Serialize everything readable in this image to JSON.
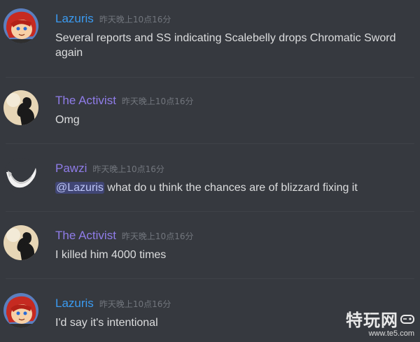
{
  "colors": {
    "background": "#36393f",
    "lazuris": "#3b9bf1",
    "activist": "#8f7ce8",
    "pawzi": "#8f7ce8",
    "timestamp": "#72767d",
    "text": "#dcddde",
    "mention_bg": "#414675"
  },
  "messages": [
    {
      "username": "Lazuris",
      "timestamp": "昨天晚上10点16分",
      "avatar": "red-haired-character-avatar",
      "text": "Several reports and SS indicating Scalebelly drops Chromatic Sword again"
    },
    {
      "username": "The Activist",
      "timestamp": "昨天晚上10点16分",
      "avatar": "silhouette-avatar",
      "text": "Omg"
    },
    {
      "username": "Pawzi",
      "timestamp": "昨天晚上10点16分",
      "avatar": "white-tail-avatar",
      "mention": "@Lazuris",
      "text": " what do u think the chances are of blizzard fixing it"
    },
    {
      "username": "The Activist",
      "timestamp": "昨天晚上10点16分",
      "avatar": "silhouette-avatar",
      "text": "I killed him 4000 times"
    },
    {
      "username": "Lazuris",
      "timestamp": "昨天晚上10点16分",
      "avatar": "red-haired-character-avatar",
      "text": "I'd say it's intentional"
    }
  ],
  "watermark": {
    "logo_text": "特玩网",
    "url": "www.te5.com"
  }
}
